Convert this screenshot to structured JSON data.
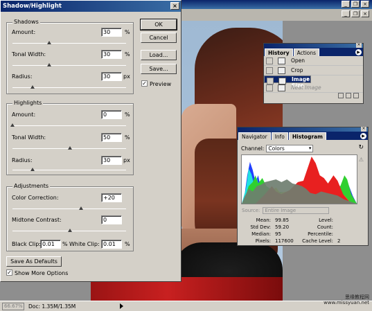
{
  "app": {
    "zoom": "66.67%",
    "doc_info": "Doc: 1.35M/1.35M",
    "watermark_line1": "思缘教程网",
    "watermark_line2": "www.missyuan.net"
  },
  "dialog": {
    "title": "Shadow/Highlight",
    "close": "×",
    "shadows": {
      "title": "Shadows",
      "amount_label": "Amount:",
      "amount": "30",
      "amount_unit": "%",
      "tonal_label": "Tonal Width:",
      "tonal": "30",
      "tonal_unit": "%",
      "radius_label": "Radius:",
      "radius": "30",
      "radius_unit": "px"
    },
    "highlights": {
      "title": "Highlights",
      "amount_label": "Amount:",
      "amount": "0",
      "amount_unit": "%",
      "tonal_label": "Tonal Width:",
      "tonal": "50",
      "tonal_unit": "%",
      "radius_label": "Radius:",
      "radius": "30",
      "radius_unit": "px"
    },
    "adjustments": {
      "title": "Adjustments",
      "color_label": "Color Correction:",
      "color": "+20",
      "midtone_label": "Midtone Contrast:",
      "midtone": "0",
      "black_label": "Black Clip:",
      "black": "0.01",
      "black_unit": "%",
      "white_label": "White Clip:",
      "white": "0.01",
      "white_unit": "%"
    },
    "buttons": {
      "ok": "OK",
      "cancel": "Cancel",
      "load": "Load...",
      "save": "Save..."
    },
    "preview_label": "Preview",
    "preview_checked": true,
    "save_defaults": "Save As Defaults",
    "show_more_label": "Show More Options",
    "show_more_checked": true
  },
  "history": {
    "tabs": [
      "History",
      "Actions"
    ],
    "items": [
      {
        "label": "Open",
        "state": "normal"
      },
      {
        "label": "Crop",
        "state": "normal"
      },
      {
        "label": "Image Size",
        "state": "selected"
      },
      {
        "label": "Neat Image",
        "state": "ghost"
      }
    ]
  },
  "histogram": {
    "tabs": [
      "Navigator",
      "Info",
      "Histogram"
    ],
    "channel_label": "Channel:",
    "channel_value": "Colors",
    "source_label": "Source:",
    "source_value": "Entire Image",
    "stats_left": [
      {
        "label": "Mean:",
        "value": "99.85"
      },
      {
        "label": "Std Dev:",
        "value": "59.20"
      },
      {
        "label": "Median:",
        "value": "95"
      },
      {
        "label": "Pixels:",
        "value": "117600"
      }
    ],
    "stats_right": [
      {
        "label": "Level:",
        "value": ""
      },
      {
        "label": "Count:",
        "value": ""
      },
      {
        "label": "Percentile:",
        "value": ""
      },
      {
        "label": "Cache Level:",
        "value": "2"
      }
    ]
  }
}
